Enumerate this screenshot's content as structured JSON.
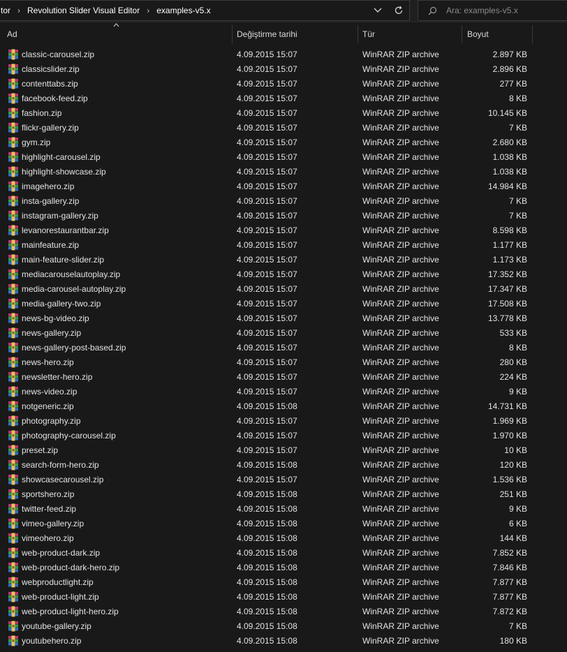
{
  "breadcrumb": [
    "tor",
    "Revolution Slider Visual Editor",
    "examples-v5.x"
  ],
  "search": {
    "placeholder": "Ara: examples-v5.x"
  },
  "columns": {
    "name": "Ad",
    "date": "Değiştirme tarihi",
    "type": "Tür",
    "size": "Boyut"
  },
  "colors": {
    "background": "#191919",
    "text": "#e3e3e3",
    "border": "#3a3a3a"
  },
  "icons": {
    "file": "winrar-archive-icon",
    "sort": "sort-ascending-icon",
    "refresh": "refresh-icon",
    "dropdown": "chevron-down-icon",
    "search": "search-icon"
  },
  "files": [
    {
      "name": "classic-carousel.zip",
      "date": "4.09.2015 15:07",
      "type": "WinRAR ZIP archive",
      "size": "2.897 KB"
    },
    {
      "name": "classicslider.zip",
      "date": "4.09.2015 15:07",
      "type": "WinRAR ZIP archive",
      "size": "2.896 KB"
    },
    {
      "name": "contenttabs.zip",
      "date": "4.09.2015 15:07",
      "type": "WinRAR ZIP archive",
      "size": "277 KB"
    },
    {
      "name": "facebook-feed.zip",
      "date": "4.09.2015 15:07",
      "type": "WinRAR ZIP archive",
      "size": "8 KB"
    },
    {
      "name": "fashion.zip",
      "date": "4.09.2015 15:07",
      "type": "WinRAR ZIP archive",
      "size": "10.145 KB"
    },
    {
      "name": "flickr-gallery.zip",
      "date": "4.09.2015 15:07",
      "type": "WinRAR ZIP archive",
      "size": "7 KB"
    },
    {
      "name": "gym.zip",
      "date": "4.09.2015 15:07",
      "type": "WinRAR ZIP archive",
      "size": "2.680 KB"
    },
    {
      "name": "highlight-carousel.zip",
      "date": "4.09.2015 15:07",
      "type": "WinRAR ZIP archive",
      "size": "1.038 KB"
    },
    {
      "name": "highlight-showcase.zip",
      "date": "4.09.2015 15:07",
      "type": "WinRAR ZIP archive",
      "size": "1.038 KB"
    },
    {
      "name": "imagehero.zip",
      "date": "4.09.2015 15:07",
      "type": "WinRAR ZIP archive",
      "size": "14.984 KB"
    },
    {
      "name": "insta-gallery.zip",
      "date": "4.09.2015 15:07",
      "type": "WinRAR ZIP archive",
      "size": "7 KB"
    },
    {
      "name": "instagram-gallery.zip",
      "date": "4.09.2015 15:07",
      "type": "WinRAR ZIP archive",
      "size": "7 KB"
    },
    {
      "name": "levanorestaurantbar.zip",
      "date": "4.09.2015 15:07",
      "type": "WinRAR ZIP archive",
      "size": "8.598 KB"
    },
    {
      "name": "mainfeature.zip",
      "date": "4.09.2015 15:07",
      "type": "WinRAR ZIP archive",
      "size": "1.177 KB"
    },
    {
      "name": "main-feature-slider.zip",
      "date": "4.09.2015 15:07",
      "type": "WinRAR ZIP archive",
      "size": "1.173 KB"
    },
    {
      "name": "mediacarouselautoplay.zip",
      "date": "4.09.2015 15:07",
      "type": "WinRAR ZIP archive",
      "size": "17.352 KB"
    },
    {
      "name": "media-carousel-autoplay.zip",
      "date": "4.09.2015 15:07",
      "type": "WinRAR ZIP archive",
      "size": "17.347 KB"
    },
    {
      "name": "media-gallery-two.zip",
      "date": "4.09.2015 15:07",
      "type": "WinRAR ZIP archive",
      "size": "17.508 KB"
    },
    {
      "name": "news-bg-video.zip",
      "date": "4.09.2015 15:07",
      "type": "WinRAR ZIP archive",
      "size": "13.778 KB"
    },
    {
      "name": "news-gallery.zip",
      "date": "4.09.2015 15:07",
      "type": "WinRAR ZIP archive",
      "size": "533 KB"
    },
    {
      "name": "news-gallery-post-based.zip",
      "date": "4.09.2015 15:07",
      "type": "WinRAR ZIP archive",
      "size": "8 KB"
    },
    {
      "name": "news-hero.zip",
      "date": "4.09.2015 15:07",
      "type": "WinRAR ZIP archive",
      "size": "280 KB"
    },
    {
      "name": "newsletter-hero.zip",
      "date": "4.09.2015 15:07",
      "type": "WinRAR ZIP archive",
      "size": "224 KB"
    },
    {
      "name": "news-video.zip",
      "date": "4.09.2015 15:07",
      "type": "WinRAR ZIP archive",
      "size": "9 KB"
    },
    {
      "name": "notgeneric.zip",
      "date": "4.09.2015 15:08",
      "type": "WinRAR ZIP archive",
      "size": "14.731 KB"
    },
    {
      "name": "photography.zip",
      "date": "4.09.2015 15:07",
      "type": "WinRAR ZIP archive",
      "size": "1.969 KB"
    },
    {
      "name": "photography-carousel.zip",
      "date": "4.09.2015 15:07",
      "type": "WinRAR ZIP archive",
      "size": "1.970 KB"
    },
    {
      "name": "preset.zip",
      "date": "4.09.2015 15:07",
      "type": "WinRAR ZIP archive",
      "size": "10 KB"
    },
    {
      "name": "search-form-hero.zip",
      "date": "4.09.2015 15:08",
      "type": "WinRAR ZIP archive",
      "size": "120 KB"
    },
    {
      "name": "showcasecarousel.zip",
      "date": "4.09.2015 15:07",
      "type": "WinRAR ZIP archive",
      "size": "1.536 KB"
    },
    {
      "name": "sportshero.zip",
      "date": "4.09.2015 15:08",
      "type": "WinRAR ZIP archive",
      "size": "251 KB"
    },
    {
      "name": "twitter-feed.zip",
      "date": "4.09.2015 15:08",
      "type": "WinRAR ZIP archive",
      "size": "9 KB"
    },
    {
      "name": "vimeo-gallery.zip",
      "date": "4.09.2015 15:08",
      "type": "WinRAR ZIP archive",
      "size": "6 KB"
    },
    {
      "name": "vimeohero.zip",
      "date": "4.09.2015 15:08",
      "type": "WinRAR ZIP archive",
      "size": "144 KB"
    },
    {
      "name": "web-product-dark.zip",
      "date": "4.09.2015 15:08",
      "type": "WinRAR ZIP archive",
      "size": "7.852 KB"
    },
    {
      "name": "web-product-dark-hero.zip",
      "date": "4.09.2015 15:08",
      "type": "WinRAR ZIP archive",
      "size": "7.846 KB"
    },
    {
      "name": "webproductlight.zip",
      "date": "4.09.2015 15:08",
      "type": "WinRAR ZIP archive",
      "size": "7.877 KB"
    },
    {
      "name": "web-product-light.zip",
      "date": "4.09.2015 15:08",
      "type": "WinRAR ZIP archive",
      "size": "7.877 KB"
    },
    {
      "name": "web-product-light-hero.zip",
      "date": "4.09.2015 15:08",
      "type": "WinRAR ZIP archive",
      "size": "7.872 KB"
    },
    {
      "name": "youtube-gallery.zip",
      "date": "4.09.2015 15:08",
      "type": "WinRAR ZIP archive",
      "size": "7 KB"
    },
    {
      "name": "youtubehero.zip",
      "date": "4.09.2015 15:08",
      "type": "WinRAR ZIP archive",
      "size": "180 KB"
    }
  ]
}
